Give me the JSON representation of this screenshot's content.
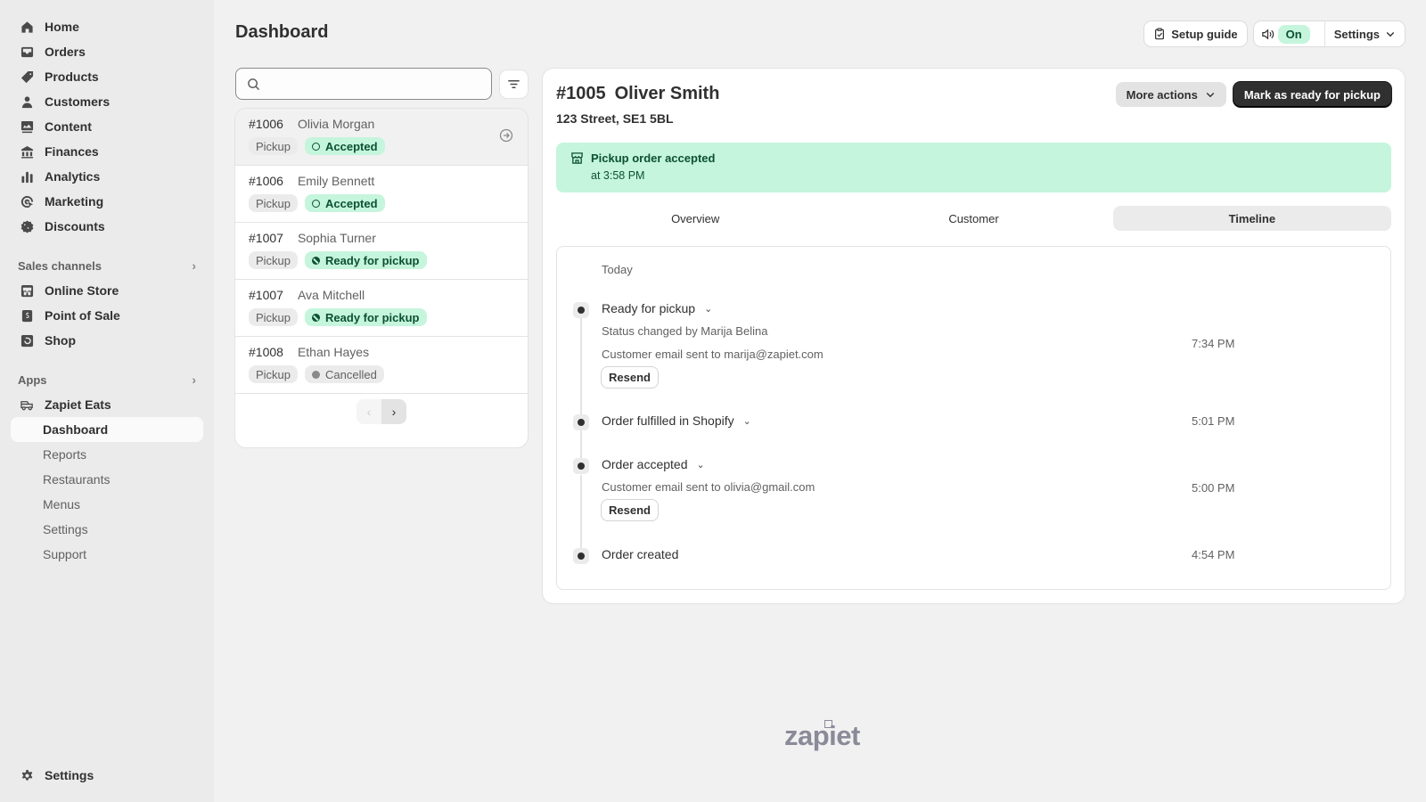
{
  "sidebar": {
    "main_nav": [
      {
        "label": "Home",
        "icon": "home-icon"
      },
      {
        "label": "Orders",
        "icon": "inbox-icon"
      },
      {
        "label": "Products",
        "icon": "tag-icon"
      },
      {
        "label": "Customers",
        "icon": "person-icon"
      },
      {
        "label": "Content",
        "icon": "image-icon"
      },
      {
        "label": "Finances",
        "icon": "bank-icon"
      },
      {
        "label": "Analytics",
        "icon": "bar-chart-icon"
      },
      {
        "label": "Marketing",
        "icon": "target-icon"
      },
      {
        "label": "Discounts",
        "icon": "discount-icon"
      }
    ],
    "sales_channels": {
      "heading": "Sales channels",
      "items": [
        {
          "label": "Online Store",
          "icon": "store-icon"
        },
        {
          "label": "Point of Sale",
          "icon": "pos-icon"
        },
        {
          "label": "Shop",
          "icon": "shop-icon"
        }
      ]
    },
    "apps": {
      "heading": "Apps",
      "app_name": "Zapiet Eats",
      "sub_items": [
        {
          "label": "Dashboard",
          "active": true
        },
        {
          "label": "Reports"
        },
        {
          "label": "Restaurants"
        },
        {
          "label": "Menus"
        },
        {
          "label": "Settings"
        },
        {
          "label": "Support"
        }
      ]
    },
    "settings_label": "Settings"
  },
  "header": {
    "title": "Dashboard",
    "setup_guide_label": "Setup guide",
    "sound_status": "On",
    "settings_label": "Settings"
  },
  "order_list": {
    "search_placeholder": "",
    "orders": [
      {
        "number": "#1006",
        "name": "Olivia Morgan",
        "type": "Pickup",
        "status": "Accepted",
        "status_kind": "accepted",
        "selected": true
      },
      {
        "number": "#1006",
        "name": "Emily Bennett",
        "type": "Pickup",
        "status": "Accepted",
        "status_kind": "accepted"
      },
      {
        "number": "#1007",
        "name": "Sophia Turner",
        "type": "Pickup",
        "status": "Ready for pickup",
        "status_kind": "ready"
      },
      {
        "number": "#1007",
        "name": "Ava Mitchell",
        "type": "Pickup",
        "status": "Ready for pickup",
        "status_kind": "ready"
      },
      {
        "number": "#1008",
        "name": "Ethan Hayes",
        "type": "Pickup",
        "status": "Cancelled",
        "status_kind": "cancelled"
      }
    ],
    "pager": {
      "prev": "‹",
      "next": "›"
    }
  },
  "detail": {
    "order_number": "#1005",
    "customer_name": "Oliver Smith",
    "address": "123 Street, SE1 5BL",
    "more_actions_label": "More actions",
    "primary_action_label": "Mark as ready for pickup",
    "banner": {
      "title": "Pickup order accepted",
      "subtitle": "at 3:58 PM"
    },
    "tabs": [
      {
        "label": "Overview"
      },
      {
        "label": "Customer"
      },
      {
        "label": "Timeline",
        "active": true
      }
    ],
    "timeline": {
      "day_label": "Today",
      "events": [
        {
          "title": "Ready for pickup",
          "time": "7:34 PM",
          "details": [
            "Status changed by Marija Belina",
            "Customer email sent to marija@zapiet.com"
          ],
          "action": "Resend"
        },
        {
          "title": "Order fulfilled in Shopify",
          "time": "5:01 PM"
        },
        {
          "title": "Order accepted",
          "time": "5:00 PM",
          "details": [
            "Customer email sent to olivia@gmail.com"
          ],
          "action": "Resend"
        },
        {
          "title": "Order created",
          "time": "4:54 PM"
        }
      ]
    }
  },
  "footer": {
    "logo_text": "zapiet"
  },
  "colors": {
    "success_bg": "#c5f5dc",
    "success_text": "#0c5132",
    "primary_button": "#303030",
    "sidebar_bg": "#ebebeb",
    "page_bg": "#f1f1f1"
  }
}
